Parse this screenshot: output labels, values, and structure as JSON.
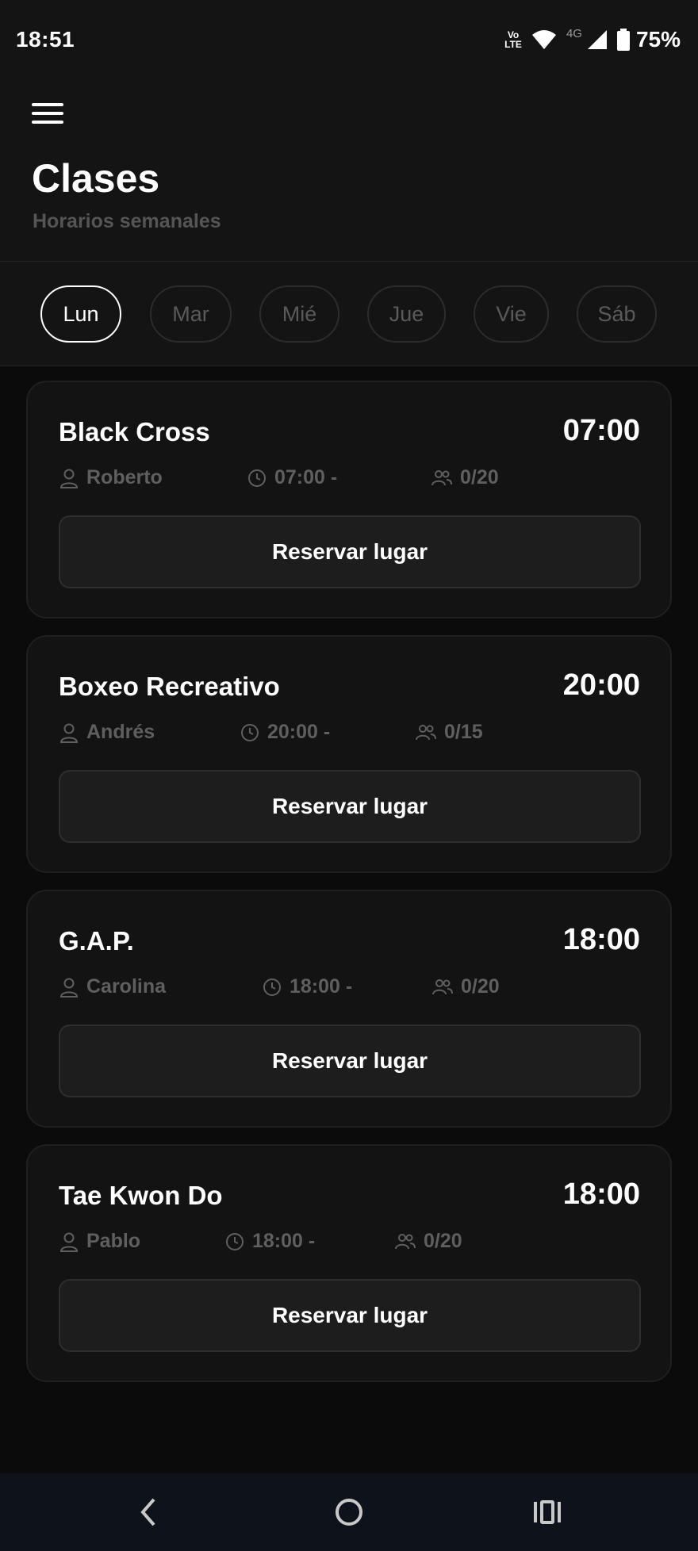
{
  "status_bar": {
    "time": "18:51",
    "volte_top": "Vo",
    "volte_bottom": "LTE",
    "network": "4G",
    "battery": "75%"
  },
  "header": {
    "title": "Clases",
    "subtitle": "Horarios semanales"
  },
  "days": [
    {
      "label": "Lun",
      "active": true
    },
    {
      "label": "Mar",
      "active": false
    },
    {
      "label": "Mié",
      "active": false
    },
    {
      "label": "Jue",
      "active": false
    },
    {
      "label": "Vie",
      "active": false
    },
    {
      "label": "Sáb",
      "active": false
    }
  ],
  "classes": [
    {
      "name": "Black Cross",
      "time": "07:00",
      "instructor": "Roberto",
      "schedule": "07:00 -",
      "capacity": "0/20",
      "button": "Reservar lugar"
    },
    {
      "name": "Boxeo Recreativo",
      "time": "20:00",
      "instructor": "Andrés",
      "schedule": "20:00 -",
      "capacity": "0/15",
      "button": "Reservar lugar"
    },
    {
      "name": "G.A.P.",
      "time": "18:00",
      "instructor": "Carolina",
      "schedule": "18:00 -",
      "capacity": "0/20",
      "button": "Reservar lugar"
    },
    {
      "name": "Tae Kwon Do",
      "time": "18:00",
      "instructor": "Pablo",
      "schedule": "18:00 -",
      "capacity": "0/20",
      "button": "Reservar lugar"
    }
  ],
  "colors": {
    "background": "#0b0b0b",
    "surface": "#141414",
    "card": "#131313",
    "muted_text": "#5f5f5f",
    "active_border": "#ffffff"
  },
  "icons": {
    "menu": "hamburger-menu-icon",
    "instructor": "person-icon",
    "schedule": "clock-icon",
    "capacity": "group-icon",
    "nav_back": "back-chevron-icon",
    "nav_home": "home-circle-icon",
    "nav_recents": "recents-icon"
  }
}
